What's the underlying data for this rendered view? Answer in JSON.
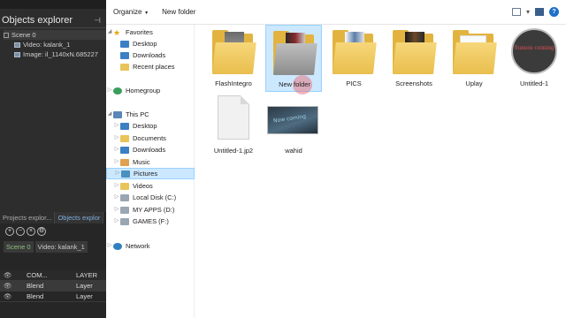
{
  "editor": {
    "panel_title": "Objects explorer",
    "tree": [
      {
        "label": "Scene 0",
        "level": 0,
        "kind": "scene"
      },
      {
        "label": "Video: kalank_1",
        "level": 1,
        "kind": "video"
      },
      {
        "label": "Image: il_1140xN.685227",
        "level": 1,
        "kind": "image"
      }
    ],
    "bottom_tabs": [
      "Projects explor...",
      "Objects explor"
    ],
    "crumbs": [
      "Scene 0",
      "Video: kalank_1"
    ],
    "layers": {
      "header": [
        "COM...",
        "LAYER"
      ],
      "rows": [
        {
          "blend": "Blend",
          "layer": "Layer"
        },
        {
          "blend": "Blend",
          "layer": "Layer"
        }
      ]
    }
  },
  "explorer": {
    "toolbar": {
      "organize": "Organize",
      "new_folder": "New folder",
      "help_icon": "?"
    },
    "nav": {
      "favorites": "Favorites",
      "favorites_items": [
        "Desktop",
        "Downloads",
        "Recent places"
      ],
      "homegroup": "Homegroup",
      "this_pc": "This PC",
      "pc_items": [
        "Desktop",
        "Documents",
        "Downloads",
        "Music",
        "Pictures",
        "Videos",
        "Local Disk (C:)",
        "MY APPS (D:)",
        "GAMES (F:)"
      ],
      "selected": "Pictures",
      "network": "Network"
    },
    "files": [
      {
        "name": "FlashIntegro",
        "type": "folder"
      },
      {
        "name": "New folder",
        "type": "folder",
        "selected": true
      },
      {
        "name": "PICS",
        "type": "folder"
      },
      {
        "name": "Screenshots",
        "type": "folder"
      },
      {
        "name": "Uplay",
        "type": "folder"
      },
      {
        "name": "Untitled-1",
        "type": "image-round",
        "thumb_text": "Sumon coming"
      },
      {
        "name": "Untitled-1.jp2",
        "type": "document"
      },
      {
        "name": "wahid",
        "type": "image",
        "thumb_text": "Now coming"
      }
    ]
  },
  "colors": {
    "selection_bg": "#cce8ff",
    "selection_border": "#99d1ff",
    "folder": "#e2b43f",
    "editor_bg": "#2d2d2d",
    "accent_blue": "#1e70c8"
  }
}
